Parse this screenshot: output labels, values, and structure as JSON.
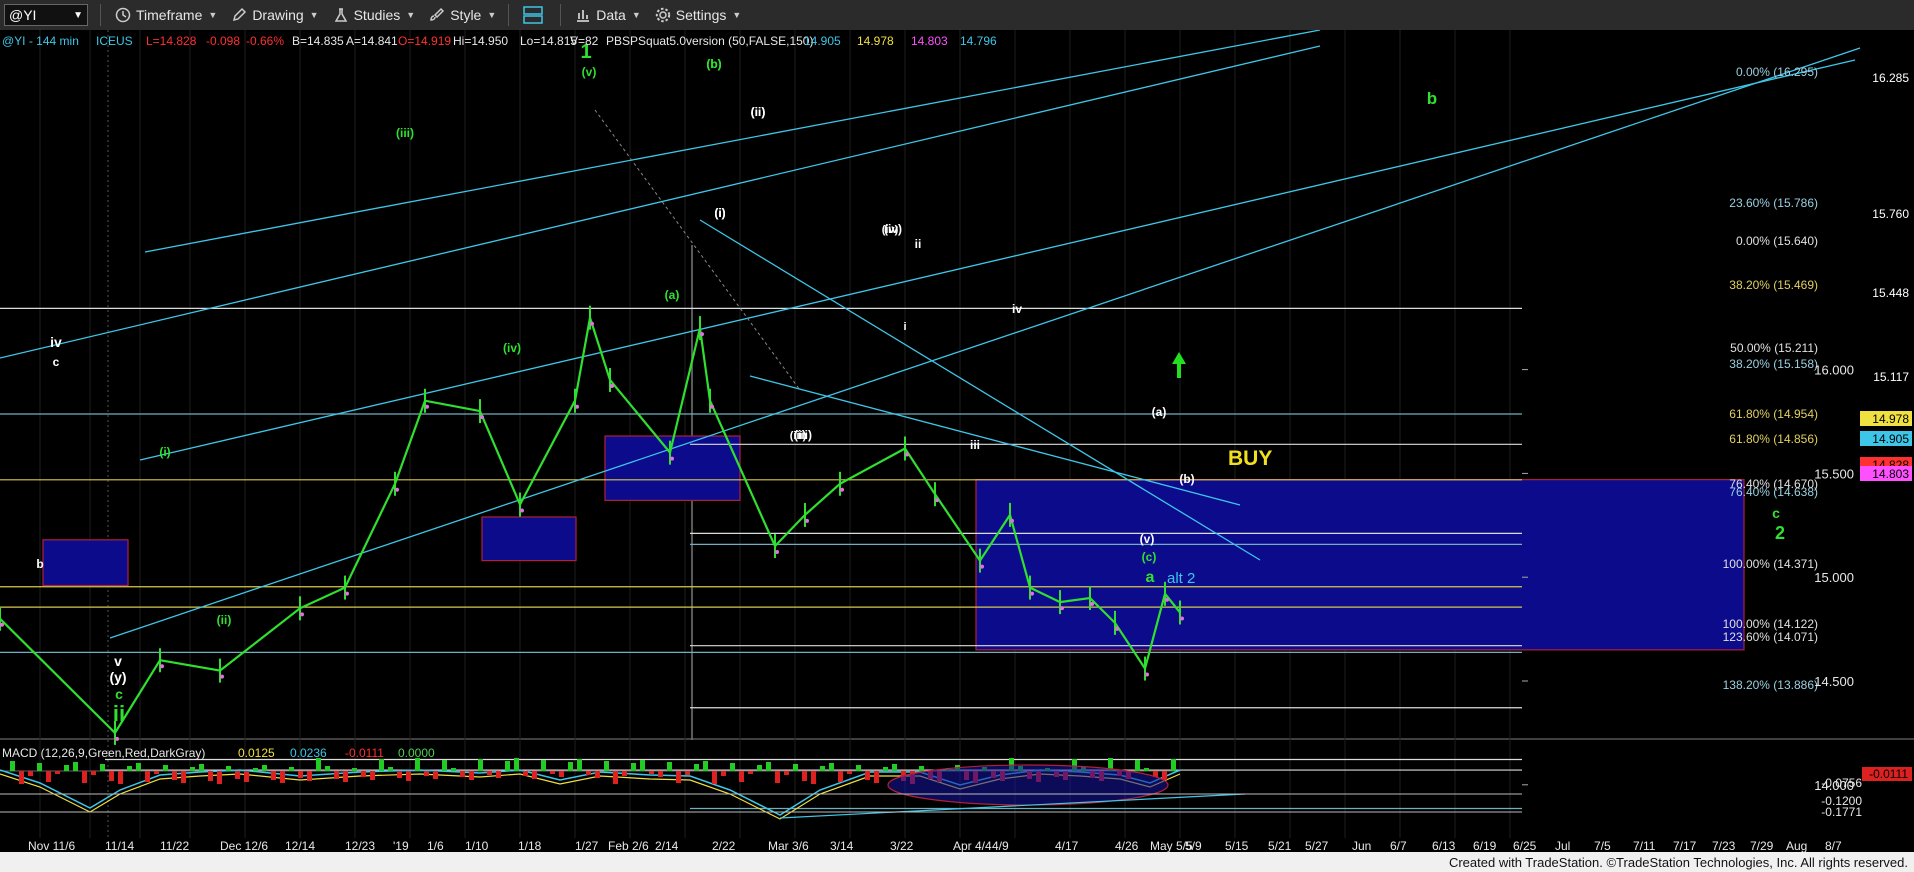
{
  "toolbar": {
    "symbol": "@YI",
    "items": [
      "Timeframe",
      "Drawing",
      "Studies",
      "Style",
      "Data",
      "Settings"
    ]
  },
  "header": {
    "instrument": "@YI - 144 min",
    "exchange": "ICEUS",
    "stats": [
      {
        "text": "L=14.828",
        "color": "#ff3030"
      },
      {
        "text": "-0.098",
        "color": "#ff3030"
      },
      {
        "text": "-0.66%",
        "color": "#ff3030"
      },
      {
        "text": "B=14.835",
        "color": "#e8e8e8"
      },
      {
        "text": "A=14.841",
        "color": "#e8e8e8"
      },
      {
        "text": "O=14.919",
        "color": "#ff3030"
      },
      {
        "text": "Hi=14.950",
        "color": "#e8e8e8"
      },
      {
        "text": "Lo=14.815",
        "color": "#e8e8e8"
      },
      {
        "text": "V=82",
        "color": "#e8e8e8"
      },
      {
        "text": "PBSPSquat5.0version (50,FALSE,150)",
        "color": "#e8e8e8"
      },
      {
        "text": "14.905",
        "color": "#3ec6e8"
      },
      {
        "text": "14.978",
        "color": "#f0e040"
      },
      {
        "text": "14.803",
        "color": "#ff50ff"
      },
      {
        "text": "14.796",
        "color": "#3ec6e8"
      }
    ]
  },
  "price_axis": {
    "ticks": [
      "16.000",
      "15.500",
      "15.000",
      "14.500",
      "14.000"
    ],
    "tags": [
      {
        "text": "16.285",
        "color": "#ffffff"
      },
      {
        "text": "15.760",
        "color": "#ffffff"
      },
      {
        "text": "15.448",
        "color": "#ffffff"
      },
      {
        "text": "15.117",
        "color": "#ffffff"
      },
      {
        "text": "14.978",
        "color": "#f0e040"
      },
      {
        "text": "14.905",
        "color": "#3ec6e8"
      },
      {
        "text": "14.828",
        "color": "#ff3030"
      },
      {
        "text": "14.803",
        "color": "#ff50ff"
      }
    ]
  },
  "fib_labels": [
    {
      "text": "0.00% (16.295)",
      "color": "#9ad0e0"
    },
    {
      "text": "23.60% (15.786)",
      "color": "#9ad0e0"
    },
    {
      "text": "0.00% (15.640)",
      "color": "#e0e0e0"
    },
    {
      "text": "38.20% (15.469)",
      "color": "#e0d060"
    },
    {
      "text": "50.00% (15.211)",
      "color": "#e0e0e0"
    },
    {
      "text": "38.20% (15.158)",
      "color": "#9ad0e0"
    },
    {
      "text": "61.80% (14.954)",
      "color": "#e0d060"
    },
    {
      "text": "61.80% (14.856)",
      "color": "#e0d060"
    },
    {
      "text": "76.40% (14.670)",
      "color": "#e0e0e0"
    },
    {
      "text": "76.40% (14.638)",
      "color": "#9ad0e0"
    },
    {
      "text": "100.00% (14.371)",
      "color": "#e0e0e0"
    },
    {
      "text": "100.00% (14.122)",
      "color": "#e0e0e0"
    },
    {
      "text": "123.60% (14.071)",
      "color": "#e0e0e0"
    },
    {
      "text": "138.20% (13.886)",
      "color": "#9ad0e0"
    }
  ],
  "annotations": {
    "buy": "BUY",
    "alt2": "alt 2",
    "wave_labels": [
      "1",
      "b",
      "iv",
      "c",
      "b",
      "(i)",
      "(ii)",
      "(iii)",
      "(iv)",
      "(v)",
      "(iii)",
      "(iv)",
      "(a)",
      "(b)",
      "(i)",
      "(ii)",
      "(iii)",
      "(iv)",
      "ii",
      "i",
      "iv",
      "iii",
      "(a)",
      "(b)",
      "(v)",
      "(c)",
      "a",
      "c",
      "2",
      "v",
      "(y)",
      "c",
      "ii",
      "(ii)",
      "(i)",
      "(b)"
    ]
  },
  "macd": {
    "label": "MACD (12,26,9,Green,Red,DarkGray)",
    "values": [
      {
        "text": "0.0125",
        "color": "#f0e040"
      },
      {
        "text": "0.0236",
        "color": "#3ec6e8"
      },
      {
        "text": "-0.0111",
        "color": "#ff3030"
      },
      {
        "text": "0.0000",
        "color": "#50d050"
      }
    ],
    "axis_ticks": [
      "-0.0756",
      "-0.1200",
      "-0.1771"
    ],
    "tag": "-0.0111"
  },
  "date_axis": [
    "Nov 11/6",
    "11/14",
    "11/22",
    "Dec 12/6",
    "12/14",
    "12/23",
    "'19",
    "1/6",
    "1/10",
    "1/18",
    "1/27",
    "Feb 2/6",
    "2/14",
    "2/22",
    "Mar 3/6",
    "3/14",
    "3/22",
    "Apr 4/4",
    "4/9",
    "4/17",
    "4/26",
    "May 5/5",
    "5/9",
    "5/15",
    "5/21",
    "5/27",
    "Jun",
    "6/7",
    "6/13",
    "6/19",
    "6/25",
    "Jul",
    "7/5",
    "7/11",
    "7/17",
    "7/23",
    "7/29",
    "Aug",
    "8/7"
  ],
  "footer": "Created with TradeStation. ©TradeStation Technologies, Inc. All rights reserved.",
  "chart_data": {
    "type": "line",
    "instrument": "@YI",
    "interval": "144 min",
    "ylim": [
      13.7,
      16.5
    ],
    "series": [
      {
        "name": "@YI",
        "x": [
          "11/6",
          "11/14",
          "11/22",
          "12/6",
          "12/14",
          "12/23",
          "1/2",
          "1/6",
          "1/10",
          "1/18",
          "1/27",
          "2/1",
          "2/6",
          "2/14",
          "2/20",
          "2/22",
          "3/6",
          "3/10",
          "3/14",
          "3/22",
          "3/25",
          "4/4",
          "4/9",
          "4/12",
          "4/17",
          "4/26",
          "5/1",
          "5/5",
          "5/7",
          "5/9"
        ],
        "y": [
          14.8,
          14.25,
          14.6,
          14.55,
          14.85,
          14.95,
          15.45,
          15.85,
          15.8,
          15.35,
          15.85,
          16.25,
          15.95,
          15.6,
          16.2,
          15.85,
          15.15,
          15.3,
          15.45,
          15.62,
          15.4,
          15.08,
          15.3,
          14.95,
          14.88,
          14.9,
          14.78,
          14.56,
          14.92,
          14.83
        ]
      }
    ],
    "fib_levels": [
      16.295,
      15.786,
      15.64,
      15.469,
      15.211,
      15.158,
      14.954,
      14.856,
      14.67,
      14.638,
      14.371,
      14.122,
      14.071,
      13.886
    ],
    "horizontal_lines": [
      16.285,
      15.76,
      15.448,
      15.117
    ],
    "target_zone": [
      14.65,
      15.47
    ]
  }
}
